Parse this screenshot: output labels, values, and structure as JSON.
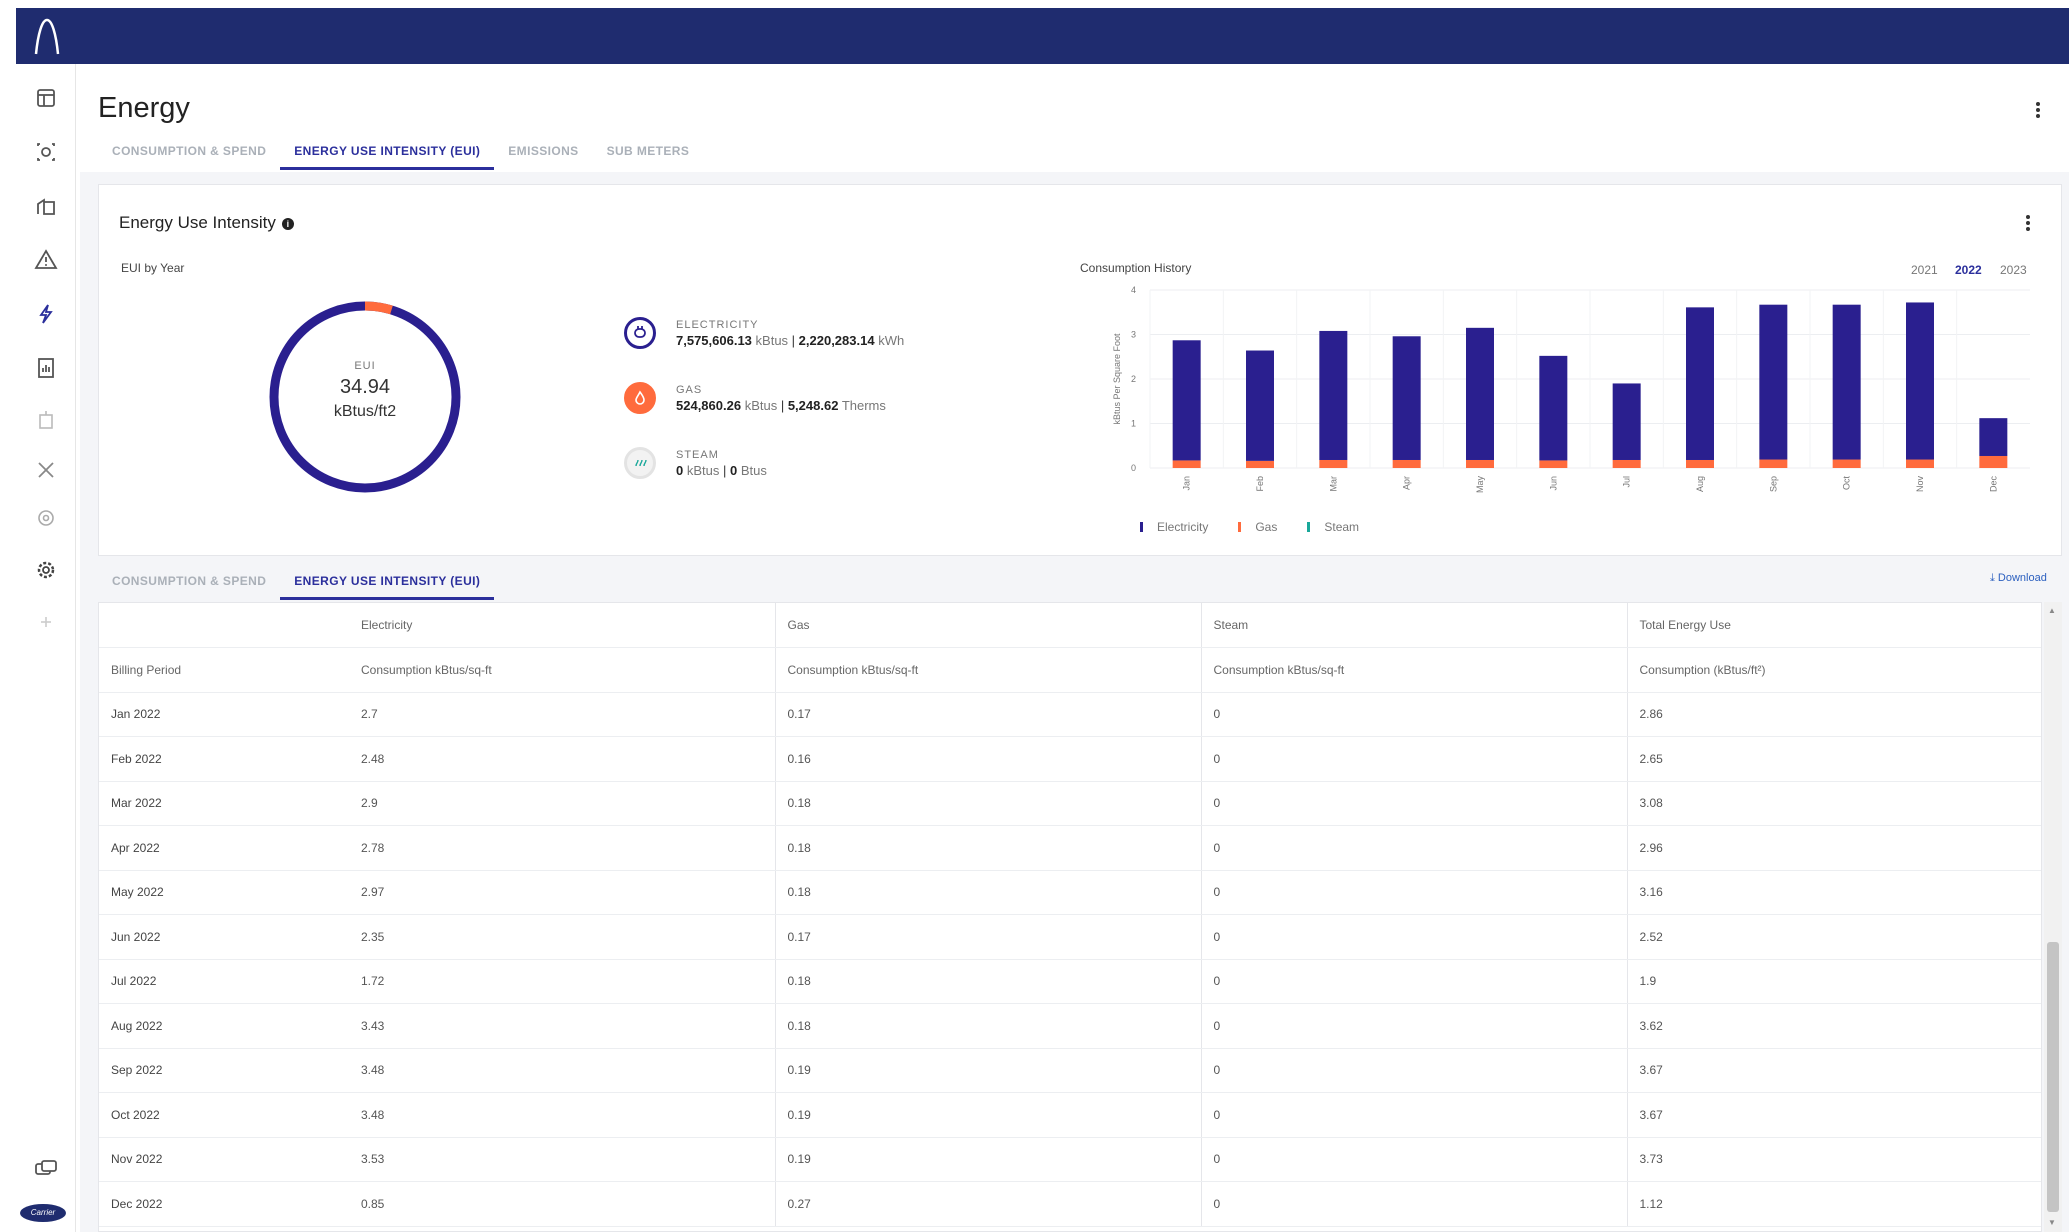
{
  "app": {
    "page_title": "Energy",
    "tabs": [
      {
        "label": "CONSUMPTION & SPEND",
        "active": false
      },
      {
        "label": "ENERGY USE INTENSITY (EUI)",
        "active": true
      },
      {
        "label": "EMISSIONS",
        "active": false
      },
      {
        "label": "SUB METERS",
        "active": false
      }
    ],
    "brand_text": "Carrier",
    "colors": {
      "topbar": "#1f2c6f",
      "accent": "#2b2f9c",
      "electricity": "#2a1f8f",
      "gas": "#ff6b3d",
      "steam": "#1aa89a"
    }
  },
  "sidebar": {
    "icons": [
      "dashboard-icon",
      "hub-icon",
      "buildings-icon",
      "alert-icon",
      "energy-bolt-icon",
      "report-icon",
      "building-icon",
      "tools-icon",
      "target-icon",
      "settings-icon",
      "plus-icon",
      "chat-icon"
    ]
  },
  "eui_card": {
    "title": "Energy Use Intensity",
    "info_icon": "i",
    "eui_by_year_label": "EUI by Year",
    "donut": {
      "label": "EUI",
      "value": "34.94",
      "unit": "kBtus/ft2",
      "gas_fraction": 0.047
    },
    "legend": [
      {
        "name": "ELECTRICITY",
        "value1": "7,575,606.13",
        "unit1": "kBtus",
        "value2": "2,220,283.14",
        "unit2": "kWh",
        "icon": "plug-icon"
      },
      {
        "name": "GAS",
        "value1": "524,860.26",
        "unit1": "kBtus",
        "value2": "5,248.62",
        "unit2": "Therms",
        "icon": "flame-icon"
      },
      {
        "name": "STEAM",
        "value1": "0",
        "unit1": "kBtus",
        "value2": "0",
        "unit2": "Btus",
        "icon": "steam-icon"
      }
    ],
    "history_label": "Consumption History",
    "years": [
      {
        "label": "2021",
        "active": false
      },
      {
        "label": "2022",
        "active": true
      },
      {
        "label": "2023",
        "active": false
      }
    ],
    "chart_legend": [
      "Electricity",
      "Gas",
      "Steam"
    ]
  },
  "chart_data": {
    "type": "bar",
    "stacked": true,
    "categories": [
      "Jan",
      "Feb",
      "Mar",
      "Apr",
      "May",
      "Jun",
      "Jul",
      "Aug",
      "Sep",
      "Oct",
      "Nov",
      "Dec"
    ],
    "series": [
      {
        "name": "Electricity",
        "values": [
          2.7,
          2.48,
          2.9,
          2.78,
          2.97,
          2.35,
          1.72,
          3.43,
          3.48,
          3.48,
          3.53,
          0.85
        ]
      },
      {
        "name": "Gas",
        "values": [
          0.17,
          0.16,
          0.18,
          0.18,
          0.18,
          0.17,
          0.18,
          0.18,
          0.19,
          0.19,
          0.19,
          0.27
        ]
      },
      {
        "name": "Steam",
        "values": [
          0,
          0,
          0,
          0,
          0,
          0,
          0,
          0,
          0,
          0,
          0,
          0
        ]
      }
    ],
    "ylabel": "kBtus Per Square Foot",
    "ylim": [
      0,
      4
    ],
    "yticks": [
      0,
      1,
      2,
      3,
      4
    ],
    "legend_position": "bottom",
    "grid": true
  },
  "table_section": {
    "tabs": [
      {
        "label": "CONSUMPTION & SPEND",
        "active": false
      },
      {
        "label": "ENERGY USE INTENSITY (EUI)",
        "active": true
      }
    ],
    "download_label": "Download",
    "group_headers": [
      "",
      "Electricity",
      "Gas",
      "Steam",
      "Total Energy Use"
    ],
    "sub_headers": [
      "Billing Period",
      "Consumption kBtus/sq-ft",
      "Consumption kBtus/sq-ft",
      "Consumption kBtus/sq-ft",
      "Consumption (kBtus/ft²)"
    ],
    "rows": [
      [
        "Jan 2022",
        "2.7",
        "0.17",
        "0",
        "2.86"
      ],
      [
        "Feb 2022",
        "2.48",
        "0.16",
        "0",
        "2.65"
      ],
      [
        "Mar 2022",
        "2.9",
        "0.18",
        "0",
        "3.08"
      ],
      [
        "Apr 2022",
        "2.78",
        "0.18",
        "0",
        "2.96"
      ],
      [
        "May 2022",
        "2.97",
        "0.18",
        "0",
        "3.16"
      ],
      [
        "Jun 2022",
        "2.35",
        "0.17",
        "0",
        "2.52"
      ],
      [
        "Jul 2022",
        "1.72",
        "0.18",
        "0",
        "1.9"
      ],
      [
        "Aug 2022",
        "3.43",
        "0.18",
        "0",
        "3.62"
      ],
      [
        "Sep 2022",
        "3.48",
        "0.19",
        "0",
        "3.67"
      ],
      [
        "Oct 2022",
        "3.48",
        "0.19",
        "0",
        "3.67"
      ],
      [
        "Nov 2022",
        "3.53",
        "0.19",
        "0",
        "3.73"
      ],
      [
        "Dec 2022",
        "0.85",
        "0.27",
        "0",
        "1.12"
      ]
    ]
  }
}
